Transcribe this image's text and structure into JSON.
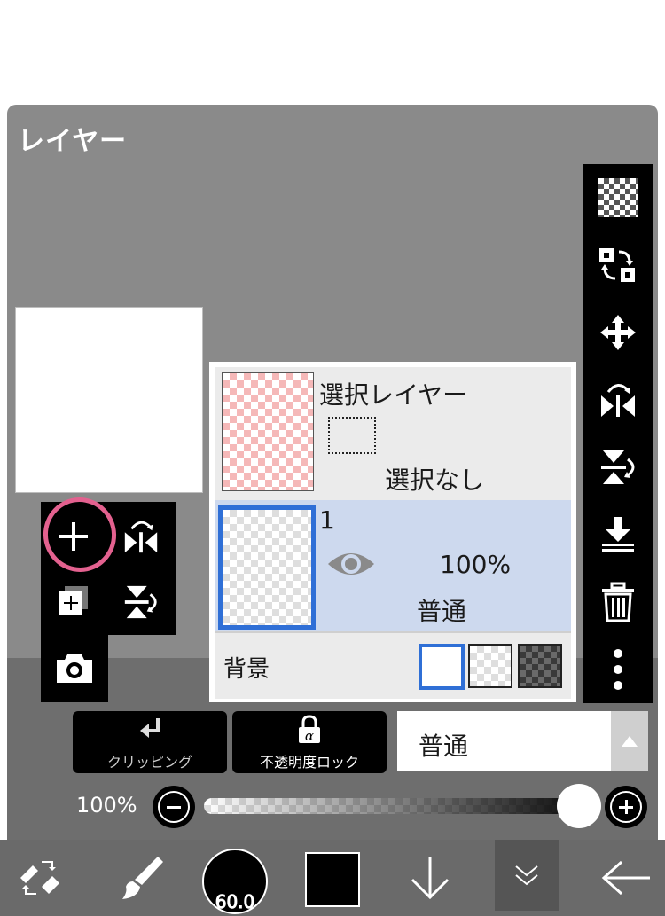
{
  "panel": {
    "title": "レイヤー"
  },
  "layers": {
    "selection_layer": {
      "name": "選択レイヤー",
      "status": "選択なし"
    },
    "layer1": {
      "name": "1",
      "opacity": "100%",
      "blend": "普通"
    },
    "background": {
      "label": "背景"
    }
  },
  "controls": {
    "clipping_label": "クリッピング",
    "alpha_lock_label": "不透明度ロック",
    "blend_mode": "普通",
    "opacity_label": "100%",
    "opacity_value": 1.0
  },
  "bottom_toolbar": {
    "brush_size": "60.0"
  },
  "icons": {
    "right_toolbar": [
      "transparent-checker-icon",
      "swap-layers-icon",
      "move-icon",
      "flip-horizontal-icon",
      "flip-vertical-icon",
      "merge-down-icon",
      "trash-icon",
      "more-vertical-icon"
    ],
    "left_tools": [
      "add-layer-icon",
      "flip-horizontal-icon",
      "duplicate-layer-icon",
      "flip-vertical-icon",
      "camera-icon"
    ],
    "bottom": [
      "tool-swap-icon",
      "brush-icon",
      "brush-size-icon",
      "color-swatch-icon",
      "down-arrow-icon",
      "collapse-icon",
      "back-arrow-icon"
    ]
  },
  "colors": {
    "highlight_blue": "#2f6fd6",
    "annotation_pink": "#e3618f",
    "selected_layer_bg": "#cdd9ee"
  }
}
